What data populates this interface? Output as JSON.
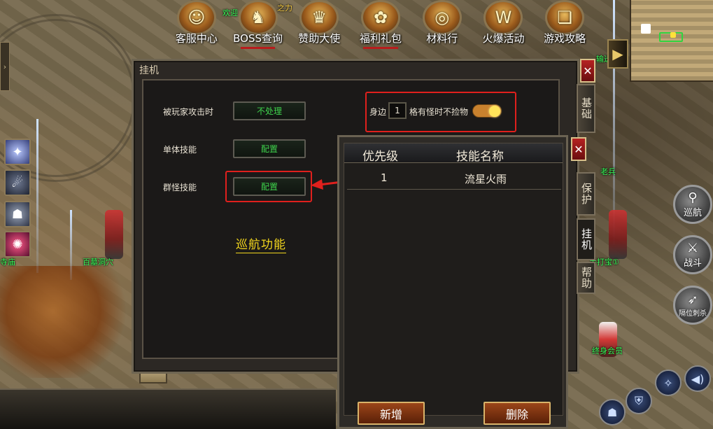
{
  "top_menu": [
    {
      "label": "客服中心",
      "icon": "customer-service-icon",
      "glyph": "☺"
    },
    {
      "label": "BOSS查询",
      "icon": "boss-dragon-icon",
      "glyph": "♞"
    },
    {
      "label": "赞助大使",
      "icon": "sponsor-emblem-icon",
      "glyph": "♛"
    },
    {
      "label": "福利礼包",
      "icon": "gift-bag-icon",
      "glyph": "✿"
    },
    {
      "label": "材料行",
      "icon": "coin-icon",
      "glyph": "◎"
    },
    {
      "label": "火爆活动",
      "icon": "w-badge-icon",
      "glyph": "W"
    },
    {
      "label": "游戏攻略",
      "icon": "guide-book-icon",
      "glyph": "❏"
    }
  ],
  "panel": {
    "title": "挂机",
    "close": "✕",
    "side_tabs": [
      "基础",
      "保护",
      "挂机",
      "帮助"
    ],
    "rows": {
      "attacked_label": "被玩家攻击时",
      "attacked_value": "不处理",
      "single_skill_label": "单体技能",
      "single_skill_value": "配置",
      "group_skill_label": "群怪技能",
      "group_skill_value": "配置"
    },
    "pickup": {
      "prefix": "身边",
      "count": "1",
      "suffix": "格有怪时不捡物",
      "enabled": true
    },
    "cruise_label": "巡航功能"
  },
  "skill_list": {
    "close": "✕",
    "columns": [
      "优先级",
      "技能名称"
    ],
    "rows": [
      {
        "priority": "1",
        "name": "流星火雨"
      }
    ],
    "add_label": "新增",
    "delete_label": "删除"
  },
  "actions": {
    "patrol": "巡航",
    "fight": "战斗",
    "skill": "隔位刺杀"
  },
  "world_labels": {
    "npc_left_1": "寺庙",
    "npc_left_2": "百墓洞穴",
    "npc_right_1": "老兵",
    "npc_right_2": "手打宝①",
    "npc_right_3": "终身会员",
    "npc_top": "欢迎",
    "npc_top2": "之力",
    "npc_top3": "输送"
  },
  "colors": {
    "accent_green": "#3fd34c",
    "highlight_red": "#e0201d",
    "cruise_yellow": "#f3d71d",
    "toggle_on": "#c8812e"
  }
}
